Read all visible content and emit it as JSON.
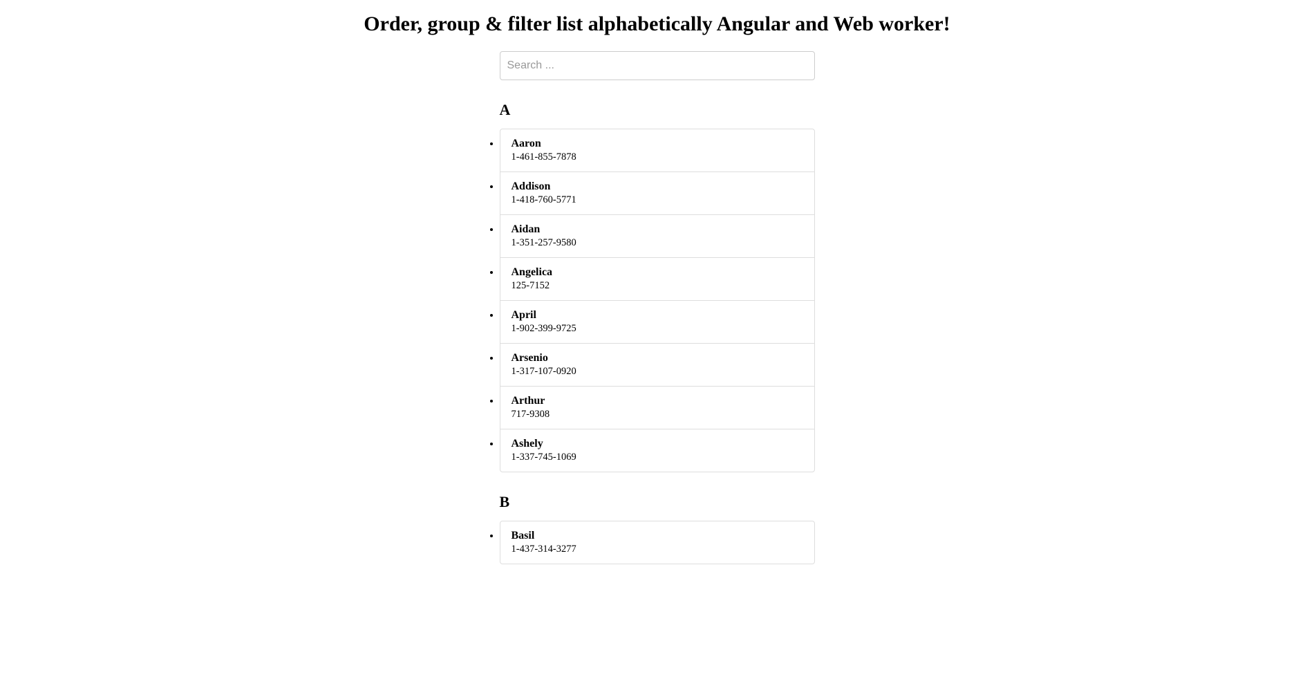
{
  "title": "Order, group & filter list alphabetically Angular and Web worker!",
  "search": {
    "placeholder": "Search ...",
    "value": ""
  },
  "groups": [
    {
      "letter": "A",
      "items": [
        {
          "name": "Aaron",
          "phone": "1-461-855-7878"
        },
        {
          "name": "Addison",
          "phone": "1-418-760-5771"
        },
        {
          "name": "Aidan",
          "phone": "1-351-257-9580"
        },
        {
          "name": "Angelica",
          "phone": "125-7152"
        },
        {
          "name": "April",
          "phone": "1-902-399-9725"
        },
        {
          "name": "Arsenio",
          "phone": "1-317-107-0920"
        },
        {
          "name": "Arthur",
          "phone": "717-9308"
        },
        {
          "name": "Ashely",
          "phone": "1-337-745-1069"
        }
      ]
    },
    {
      "letter": "B",
      "items": [
        {
          "name": "Basil",
          "phone": "1-437-314-3277"
        }
      ]
    }
  ]
}
